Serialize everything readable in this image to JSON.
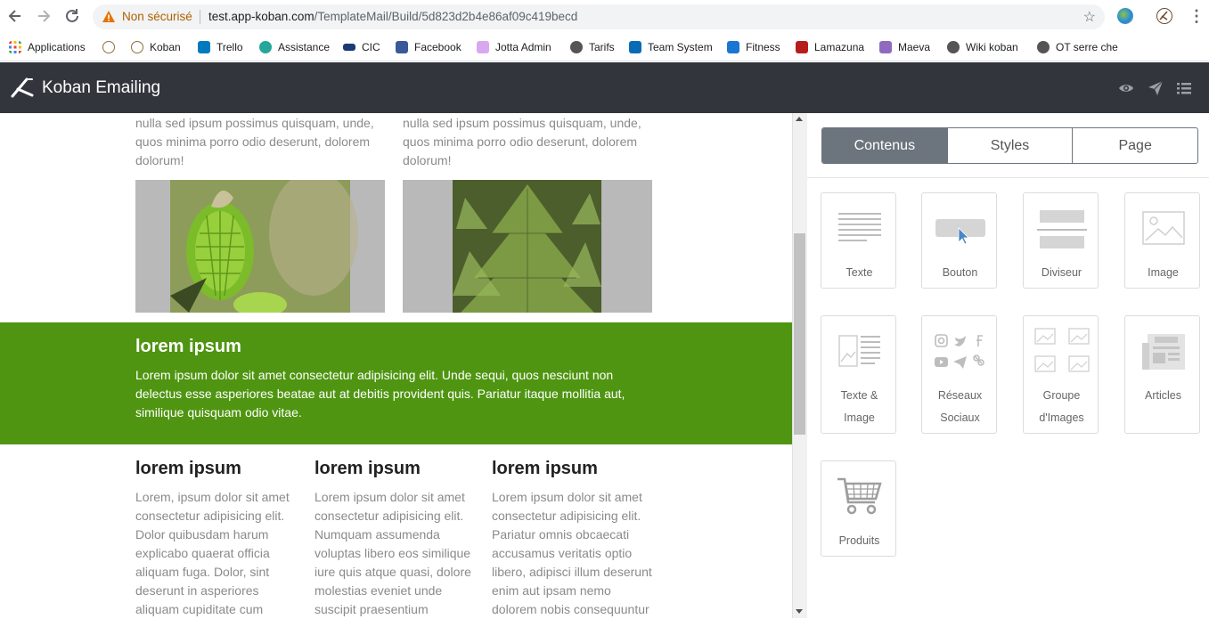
{
  "browser": {
    "insecure_label": "Non sécurisé",
    "url_host": "test.app-koban.com",
    "url_path": "/TemplateMail/Build/5d823d2b4e86af09c419becd"
  },
  "bookmarks": [
    {
      "label": "Applications",
      "color": "#4285f4"
    },
    {
      "label": "",
      "color": "#8d6e3f"
    },
    {
      "label": "Koban",
      "color": "#8d6e3f"
    },
    {
      "label": "Trello",
      "color": "#0079bf"
    },
    {
      "label": "Assistance",
      "color": "#26a69a"
    },
    {
      "label": "CIC",
      "color": "#1a3c74"
    },
    {
      "label": "Facebook",
      "color": "#3b5998"
    },
    {
      "label": "Jotta Admin",
      "color": "#d9a7f0"
    },
    {
      "label": "Tarifs",
      "color": "#555555"
    },
    {
      "label": "Team System",
      "color": "#0a6bb5"
    },
    {
      "label": "Fitness",
      "color": "#1976d2"
    },
    {
      "label": "Lamazuna",
      "color": "#b71c1c"
    },
    {
      "label": "Maeva",
      "color": "#8e6bbf"
    },
    {
      "label": "Wiki koban",
      "color": "#555555"
    },
    {
      "label": "OT serre che",
      "color": "#555555"
    }
  ],
  "app": {
    "title": "Koban Emailing"
  },
  "canvas": {
    "col1_top_text": "nulla sed ipsum possimus quisquam, unde, quos minima porro odio deserunt, dolorem dolorum!",
    "col2_top_text": "nulla sed ipsum possimus quisquam, unde, quos minima porro odio deserunt, dolorem dolorum!",
    "band_title": "lorem ipsum",
    "band_text": "Lorem ipsum dolor sit amet consectetur adipisicing elit. Unde sequi, quos nesciunt non delectus esse asperiores beatae aut at debitis provident quis. Pariatur itaque mollitia aut, similique quisquam odio vitae.",
    "columns": [
      {
        "title": "lorem ipsum",
        "text": "Lorem, ipsum dolor sit amet consectetur adipisicing elit. Dolor quibusdam harum explicabo quaerat officia aliquam fuga. Dolor, sint deserunt in asperiores aliquam cupiditate cum"
      },
      {
        "title": "lorem ipsum",
        "text": "Lorem ipsum dolor sit amet consectetur adipisicing elit. Numquam assumenda voluptas libero eos similique iure quis atque quasi, dolore molestias eveniet unde suscipit praesentium"
      },
      {
        "title": "lorem ipsum",
        "text": "Lorem ipsum dolor sit amet consectetur adipisicing elit. Pariatur omnis obcaecati accusamus veritatis optio libero, adipisci illum deserunt enim aut ipsam nemo dolorem nobis consequuntur"
      }
    ],
    "band_color": "#4f9511"
  },
  "sidebar": {
    "tabs": [
      "Contenus",
      "Styles",
      "Page"
    ],
    "active_tab": "Contenus",
    "blocks": [
      {
        "label": "Texte",
        "icon": "text-block-icon"
      },
      {
        "label": "Bouton",
        "icon": "button-block-icon"
      },
      {
        "label": "Diviseur",
        "icon": "divider-block-icon"
      },
      {
        "label": "Image",
        "icon": "image-block-icon"
      },
      {
        "label": "Texte &",
        "label2": "Image",
        "icon": "text-image-block-icon"
      },
      {
        "label": "Réseaux",
        "label2": "Sociaux",
        "icon": "social-block-icon"
      },
      {
        "label": "Groupe",
        "label2": "d'Images",
        "icon": "image-group-block-icon"
      },
      {
        "label": "Articles",
        "icon": "articles-block-icon"
      },
      {
        "label": "Produits",
        "icon": "products-block-icon"
      }
    ]
  }
}
